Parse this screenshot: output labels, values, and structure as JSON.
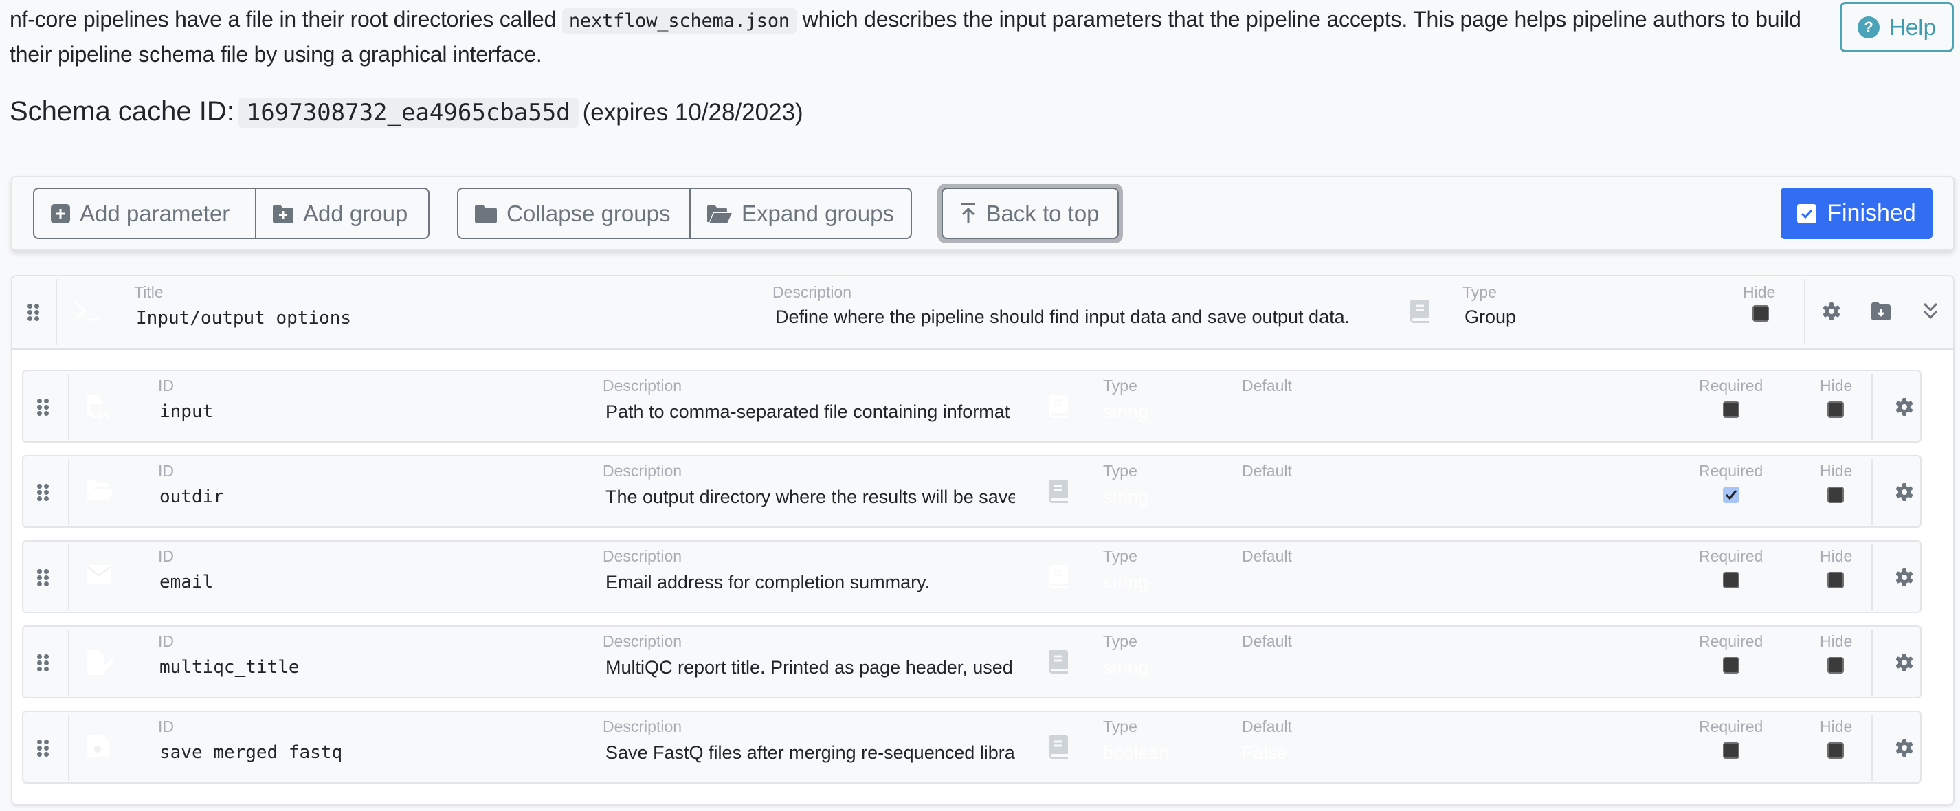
{
  "intro": {
    "text_before": "nf-core pipelines have a file in their root directories called",
    "filename": "nextflow_schema.json",
    "text_after": "which describes the input parameters that the pipeline accepts. This page helps pipeline authors to build their pipeline schema file by using a graphical interface."
  },
  "cache": {
    "label": "Schema cache ID:",
    "id": "1697308732_ea4965cba55d",
    "expires": "(expires 10/28/2023)"
  },
  "help_button": {
    "label": "Help",
    "icon": "question-circle-icon"
  },
  "toolbar": {
    "add_parameter": "Add parameter",
    "add_group": "Add group",
    "collapse_groups": "Collapse groups",
    "expand_groups": "Expand groups",
    "back_to_top": "Back to top",
    "finished": "Finished"
  },
  "colors": {
    "primary": "#326ef3",
    "info": "#4ba3b6",
    "secondary": "#6c757d",
    "checked": "#a7c6f7"
  },
  "group": {
    "title_label": "Title",
    "title": "Input/output options",
    "icon": "terminal-icon",
    "description_label": "Description",
    "description": "Define where the pipeline should find input data and save output data.",
    "type_label": "Type",
    "type": "Group",
    "hide_label": "Hide",
    "hidden": false
  },
  "param_labels": {
    "id": "ID",
    "description": "Description",
    "type": "Type",
    "default": "Default",
    "required": "Required",
    "hide": "Hide"
  },
  "params": [
    {
      "id": "input",
      "icon": "file-csv-icon",
      "description": "Path to comma-separated file containing informat",
      "type": "string",
      "default": "",
      "required": false,
      "hidden": false,
      "help_icon_faded": true
    },
    {
      "id": "outdir",
      "icon": "folder-open-icon",
      "description": "The output directory where the results will be save",
      "type": "string",
      "default": "",
      "required": true,
      "hidden": false,
      "help_icon_faded": false
    },
    {
      "id": "email",
      "icon": "envelope-icon",
      "description": "Email address for completion summary.",
      "type": "string",
      "default": "",
      "required": false,
      "hidden": false,
      "help_icon_faded": true
    },
    {
      "id": "multiqc_title",
      "icon": "file-signature-icon",
      "description": "MultiQC report title. Printed as page header, used",
      "type": "string",
      "default": "",
      "required": false,
      "hidden": false,
      "help_icon_faded": false
    },
    {
      "id": "save_merged_fastq",
      "icon": "save-icon",
      "description": "Save FastQ files after merging re-sequenced librar",
      "type": "boolean",
      "default": "False",
      "required": false,
      "hidden": false,
      "help_icon_faded": false
    }
  ]
}
